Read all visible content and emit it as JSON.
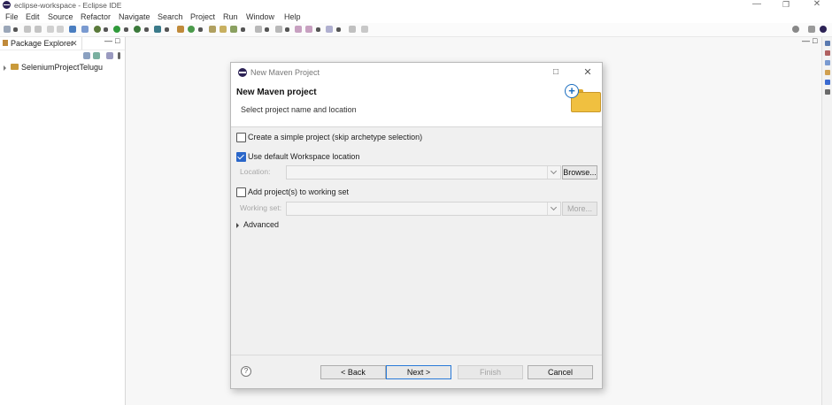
{
  "window": {
    "title": "eclipse-workspace - Eclipse IDE"
  },
  "window_controls": {
    "minimize": "—",
    "restore": "❐",
    "close": "✕"
  },
  "menu": [
    "File",
    "Edit",
    "Source",
    "Refactor",
    "Navigate",
    "Search",
    "Project",
    "Run",
    "Window",
    "Help"
  ],
  "package_explorer": {
    "tab_label": "Package Explorer",
    "tab_close": "✕",
    "minimize": "—",
    "maximize": "□",
    "project": "SeleniumProjectTelugu"
  },
  "dialog": {
    "title": "New Maven Project",
    "header_title": "New Maven project",
    "header_subtitle": "Select project name and location",
    "simple_project_label": "Create a simple project (skip archetype selection)",
    "simple_project_checked": false,
    "default_location_label": "Use default Workspace location",
    "default_location_checked": true,
    "location_label": "Location:",
    "location_value": "",
    "browse_label": "Browse...",
    "working_set_checkbox_label": "Add project(s) to working set",
    "working_set_checked": false,
    "working_set_label": "Working set:",
    "working_set_value": "",
    "more_label": "More...",
    "advanced_label": "Advanced",
    "help_label": "?",
    "buttons": {
      "back": "< Back",
      "next": "Next >",
      "finish": "Finish",
      "cancel": "Cancel"
    }
  },
  "colors": {
    "accent": "#2a66c9",
    "eclipse_purple": "#2c2255",
    "folder": "#f0c040"
  }
}
